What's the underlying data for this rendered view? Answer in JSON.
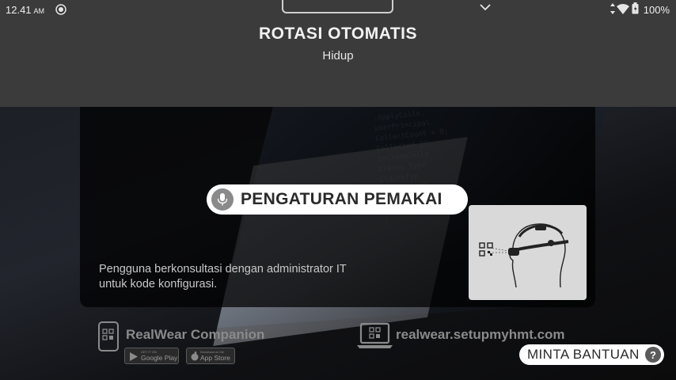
{
  "status_bar": {
    "time": "12.41",
    "ampm": "AM",
    "battery": "100%"
  },
  "overlay": {
    "title": "ROTASI OTOMATIS",
    "subtitle": "Hidup"
  },
  "card": {
    "title": "PENGATURAN PEMAKAI",
    "description": "Pengguna berkonsultasi dengan administrator IT untuk kode konfigurasi."
  },
  "companion": {
    "name": "RealWear Companion",
    "google_play_small": "GET IT ON",
    "google_play": "Google Play",
    "app_store_small": "Download on the",
    "app_store": "App Store"
  },
  "setup": {
    "url": "realwear.setupmyhmt.com"
  },
  "help": {
    "label": "MINTA BANTUAN",
    "icon_text": "?"
  },
  "icons": [
    "cast-icon",
    "wifi-icon",
    "battery-icon",
    "chevron-down-icon",
    "mic-icon",
    "qr-code-icon",
    "phone-icon",
    "laptop-icon",
    "help-icon"
  ]
}
